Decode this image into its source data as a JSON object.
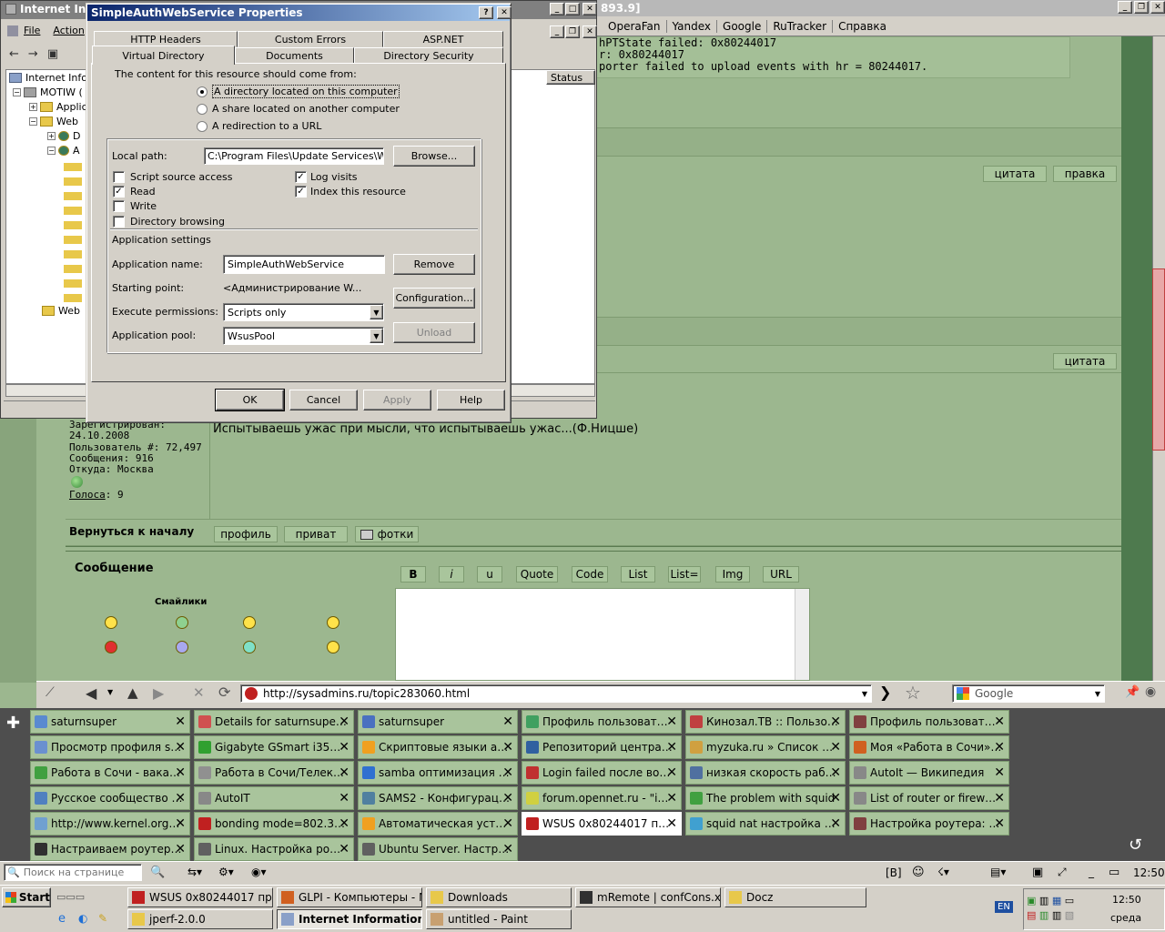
{
  "browser": {
    "url": "http://sysadmins.ru/topic283060.html",
    "search_engine": "Google",
    "menu": [
      "OperaFan",
      "Yandex",
      "Google",
      "RuTracker",
      "Справка"
    ],
    "page_title_fragment": "893.9]",
    "find_placeholder": "Поиск на странице",
    "status_mark": "[B]",
    "time": "12:50"
  },
  "log": {
    "line1": "hPTState failed: 0x80244017",
    "line2": "r: 0x80244017",
    "line3": "porter failed to upload events with hr = 80244017."
  },
  "forum": {
    "quote_btn": "цитата",
    "edit_btn": "правка",
    "quote_btn2": "цитата",
    "user_info": [
      "Зарегистрирован:",
      "24.10.2008",
      "Пользователь #: 72,497",
      "Сообщения: 916",
      "Откуда: Москва"
    ],
    "votes_label": "Голоса",
    "votes_value": ": 9",
    "signature": "Испытываешь ужас при мысли, что испытываешь ужас...(Ф.Ницше)",
    "back_to_top": "Вернуться к началу",
    "profile_btn": "профиль",
    "privat_btn": "приват",
    "photos_btn": "фотки",
    "message_label": "Сообщение",
    "smilies_label": "Смайлики",
    "editor_buttons": [
      "B",
      "i",
      "u",
      "Quote",
      "Code",
      "List",
      "List=",
      "Img",
      "URL"
    ]
  },
  "iis": {
    "title": "Internet Infor",
    "menu": [
      "File",
      "Action"
    ],
    "tree": [
      "Internet Infor",
      "MOTIW (",
      "Applic",
      "Web",
      "D",
      "A",
      "Web"
    ],
    "status_col": "Status"
  },
  "dialog": {
    "title": "SimpleAuthWebService Properties",
    "tabs_back": [
      "HTTP Headers",
      "Custom Errors",
      "ASP.NET"
    ],
    "tabs_front": [
      "Virtual Directory",
      "Documents",
      "Directory Security"
    ],
    "content_label": "The content for this resource should come from:",
    "radio": [
      "A directory located on this computer",
      "A share located on another computer",
      "A redirection to a URL"
    ],
    "local_path_label": "Local path:",
    "local_path_value": "C:\\Program Files\\Update Services\\WebS",
    "browse_btn": "Browse...",
    "checks_left": [
      "Script source access",
      "Read",
      "Write",
      "Directory browsing"
    ],
    "checks_left_state": [
      false,
      true,
      false,
      false
    ],
    "checks_right": [
      "Log visits",
      "Index this resource"
    ],
    "checks_right_state": [
      true,
      true
    ],
    "app_settings": "Application settings",
    "app_name_label": "Application name:",
    "app_name_value": "SimpleAuthWebService",
    "remove_btn": "Remove",
    "start_point_label": "Starting point:",
    "start_point_value": "<Администрирование W...",
    "config_btn": "Configuration...",
    "exec_perm_label": "Execute permissions:",
    "exec_perm_value": "Scripts only",
    "app_pool_label": "Application pool:",
    "app_pool_value": "WsusPool",
    "unload_btn": "Unload",
    "ok": "OK",
    "cancel": "Cancel",
    "apply": "Apply",
    "help": "Help"
  },
  "tabs": [
    [
      "saturnsuper",
      "Details for saturnsuper -...",
      "saturnsuper",
      "Профиль пользователя...",
      "Кинозал.ТВ :: Пользов...",
      "Профиль пользователя..."
    ],
    [
      "Просмотр профиля satu...",
      "Gigabyte GSmart i350 - ...",
      "Скриптовые языки адм...",
      "Репозиторий центра сц...",
      "myzuka.ru » Список заг...",
      "Моя «Работа в Сочи». ..."
    ],
    [
      "Работа в Сочи - вакансии",
      "Работа в Сочи/Телеком...",
      "samba оптимизация - П...",
      "Login failed после восст...",
      "низкая скорость работ...",
      "AutoIt — Википедия"
    ],
    [
      "Русское сообщество А...",
      "AutoIT",
      "SAMS2 - Конфигурацио...",
      "forum.opennet.ru - \"ipf...",
      "The problem with squid",
      "List of router or firewall ..."
    ],
    [
      "http://www.kernel.org/d...",
      "bonding mode=802.3ad ...",
      "Автоматическая устан...",
      "WSUS 0x80244017 при ...",
      "squid nat настройка - П...",
      "Настройка роутера: N..."
    ],
    [
      "Настраиваем роутер н...",
      "Linux. Настройка роуте...",
      "Ubuntu Server. Настраи..."
    ]
  ],
  "taskbar": {
    "start": "Start",
    "row1": [
      "WSUS 0x80244017 при ...",
      "GLPI - Компьютеры - M...",
      "Downloads",
      "mRemote | confCons.xml",
      "Docz"
    ],
    "row2": [
      "jperf-2.0.0",
      "Internet Information ...",
      "untitled - Paint"
    ],
    "lang": "EN",
    "clock": "12:50",
    "day": "среда"
  }
}
